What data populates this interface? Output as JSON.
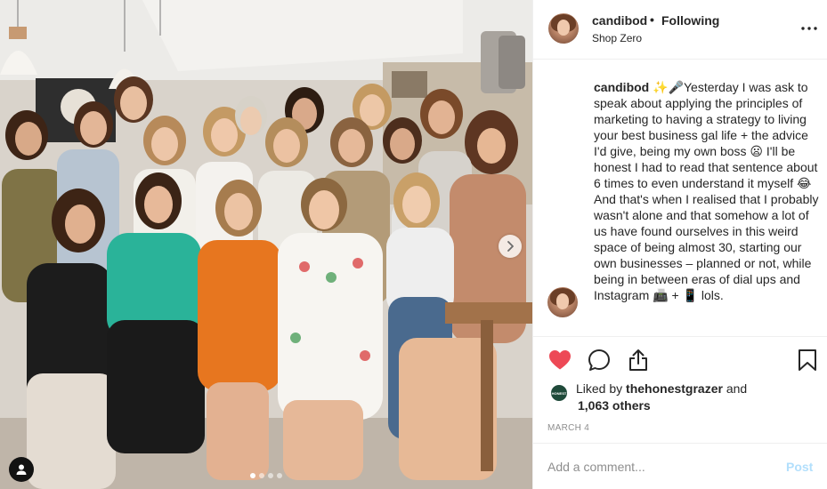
{
  "post": {
    "username": "candibod",
    "separator": "•",
    "follow_label": "Following",
    "location": "Shop Zero",
    "caption": {
      "username": "candibod",
      "text": "✨🎤Yesterday I was ask to speak about applying the principles of marketing to having a strategy to living your best business gal life + the advice I'd give, being my own boss 😦 I'll be honest I had to read that sentence about 6 times to even understand it myself 😂 And that's when I realised that I probably wasn't alone and that somehow a lot of us have found ourselves in this weird space of being almost 30, starting our own businesses – planned or not, while being in between eras of dial ups and Instagram 📠 + 📱 lols."
    },
    "likes": {
      "prefix": "Liked by",
      "liker": "thehonestgrazer",
      "and": "and",
      "others": "1,063 others",
      "badge_text": "HONEST"
    },
    "date": "MARCH 4",
    "comment": {
      "placeholder": "Add a comment...",
      "post_label": "Post"
    },
    "carousel": {
      "slide_count": 4,
      "active_index": 0
    },
    "icons": {
      "like": "heart-icon",
      "comment": "comment-icon",
      "share": "share-icon",
      "save": "bookmark-icon",
      "more": "more-options-icon",
      "next": "chevron-right-icon",
      "tag": "user-tag-icon"
    },
    "colors": {
      "like_active": "#ed4956",
      "post_disabled": "#b2dffc",
      "muted_text": "#8e8e8e"
    }
  }
}
